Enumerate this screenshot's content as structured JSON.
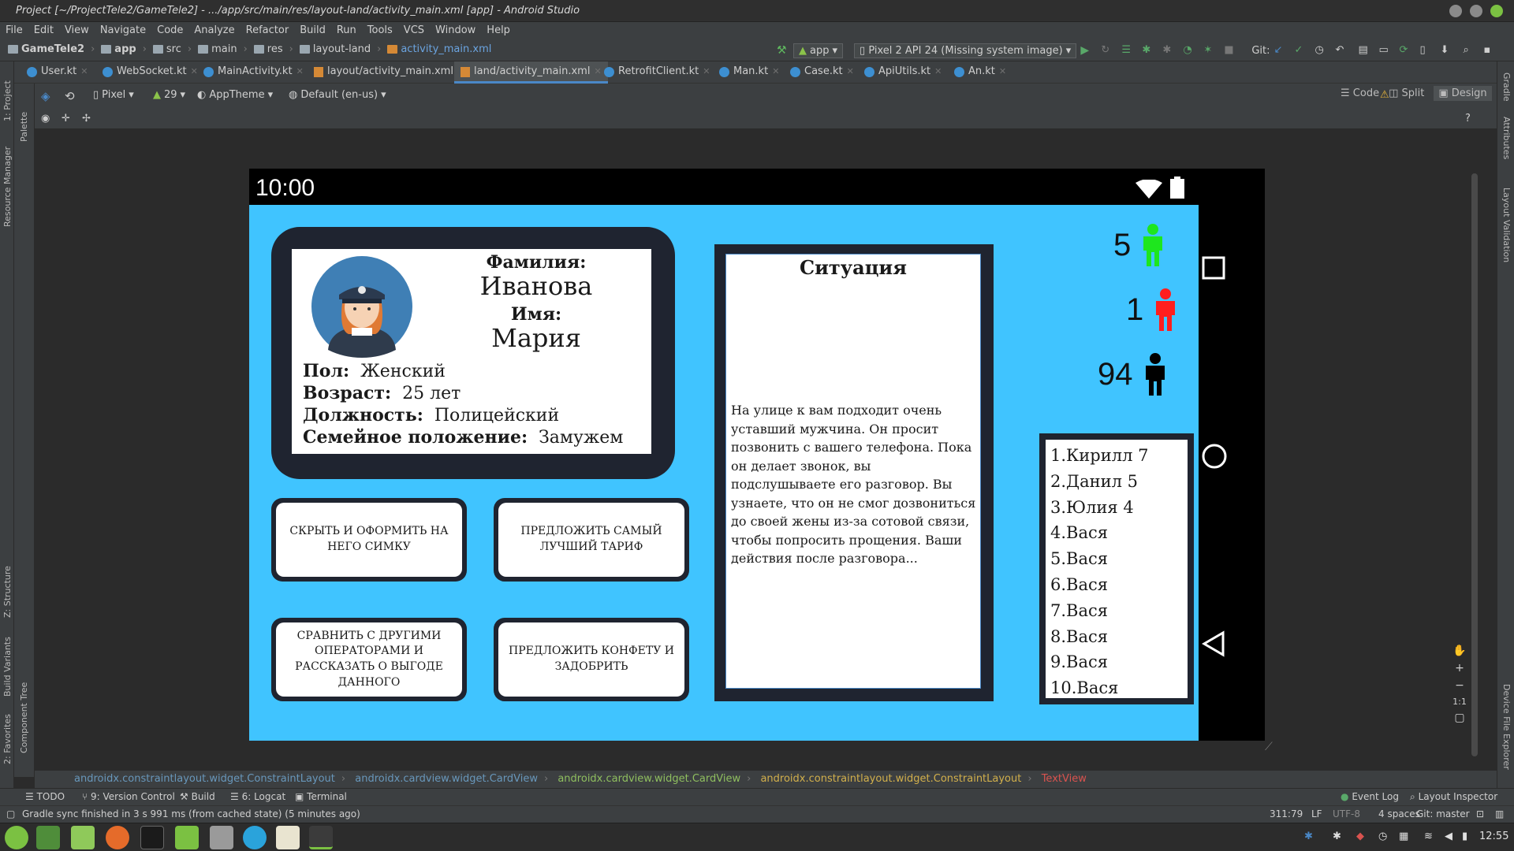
{
  "window": {
    "title": "Project [~/ProjectTele2/GameTele2] - .../app/src/main/res/layout-land/activity_main.xml [app] - Android Studio"
  },
  "menu": [
    "File",
    "Edit",
    "View",
    "Navigate",
    "Code",
    "Analyze",
    "Refactor",
    "Build",
    "Run",
    "Tools",
    "VCS",
    "Window",
    "Help"
  ],
  "breadcrumb": [
    "GameTele2",
    "app",
    "src",
    "main",
    "res",
    "layout-land",
    "activity_main.xml"
  ],
  "toolbar": {
    "module": "app",
    "device": "Pixel 2 API 24 (Missing system image)",
    "git_label": "Git:"
  },
  "tabs": [
    "User.kt",
    "WebSocket.kt",
    "MainActivity.kt",
    "layout/activity_main.xml",
    "land/activity_main.xml",
    "RetrofitClient.kt",
    "Man.kt",
    "Case.kt",
    "ApiUtils.kt",
    "An.kt"
  ],
  "view_modes": [
    "Code",
    "Split",
    "Design"
  ],
  "design_toolbar": {
    "device": "Pixel",
    "api": "29",
    "theme": "AppTheme",
    "locale": "Default (en-us)"
  },
  "left_tools": [
    "1: Project",
    "Resource Manager",
    "Palette",
    "Z: Structure",
    "Build Variants",
    "Component Tree",
    "2: Favorites"
  ],
  "right_tools": [
    "Gradle",
    "Attributes",
    "Layout Validation",
    "Device File Explorer"
  ],
  "phone": {
    "time": "10:00",
    "profile": {
      "surname_label": "Фамилия:",
      "surname": "Иванова",
      "name_label": "Имя:",
      "name": "Мария",
      "gender_label": "Пол:",
      "gender": "Женский",
      "age_label": "Возраст:",
      "age": "25 лет",
      "position_label": "Должность:",
      "position": "Полицейский",
      "family_label": "Семейное положение:",
      "family": "Замужем"
    },
    "actions": [
      "СКРЫТЬ И ОФОРМИТЬ НА НЕГО СИМКУ",
      "ПРЕДЛОЖИТЬ САМЫЙ ЛУЧШИЙ ТАРИФ",
      "СРАВНИТЬ С ДРУГИМИ ОПЕРАТОРАМИ И РАССКАЗАТЬ О ВЫГОДЕ ДАННОГО",
      "ПРЕДЛОЖИТЬ КОНФЕТУ И ЗАДОБРИТЬ"
    ],
    "situation": {
      "title": "Ситуация",
      "text": "На улице к вам подходит очень уставший мужчина. Он просит позвонить с вашего телефона. Пока он делает звонок, вы подслушываете его разговор. Вы узнаете, что он не смог дозвониться до своей жены из-за сотовой связи, чтобы попросить прощения. Ваши действия после разговора..."
    },
    "counters": [
      {
        "value": "5",
        "color": "#1ee61e"
      },
      {
        "value": "1",
        "color": "#ff1e1e"
      },
      {
        "value": "94",
        "color": "#000000"
      }
    ],
    "leaderboard": [
      "1.Кирилл 7",
      "2.Данил 5",
      "3.Юлия 4",
      "4.Вася",
      "5.Вася",
      "6.Вася",
      "7.Вася",
      "8.Вася",
      "9.Вася",
      "10.Вася"
    ]
  },
  "component_breadcrumb": [
    "androidx.constraintlayout.widget.ConstraintLayout",
    "androidx.cardview.widget.CardView",
    "androidx.cardview.widget.CardView",
    "androidx.constraintlayout.widget.ConstraintLayout",
    "TextView"
  ],
  "tool_windows": [
    "TODO",
    "9: Version Control",
    "Build",
    "6: Logcat",
    "Terminal"
  ],
  "tool_windows_right": [
    "Event Log",
    "Layout Inspector"
  ],
  "status": {
    "message": "Gradle sync finished in 3 s 991 ms (from cached state) (5 minutes ago)",
    "position": "311:79",
    "line_sep": "LF",
    "encoding": "UTF-8",
    "indent": "4 spaces",
    "vcs": "Git: master"
  },
  "zoom_controls": [
    "+",
    "−",
    "1:1"
  ],
  "clock": "12:55"
}
